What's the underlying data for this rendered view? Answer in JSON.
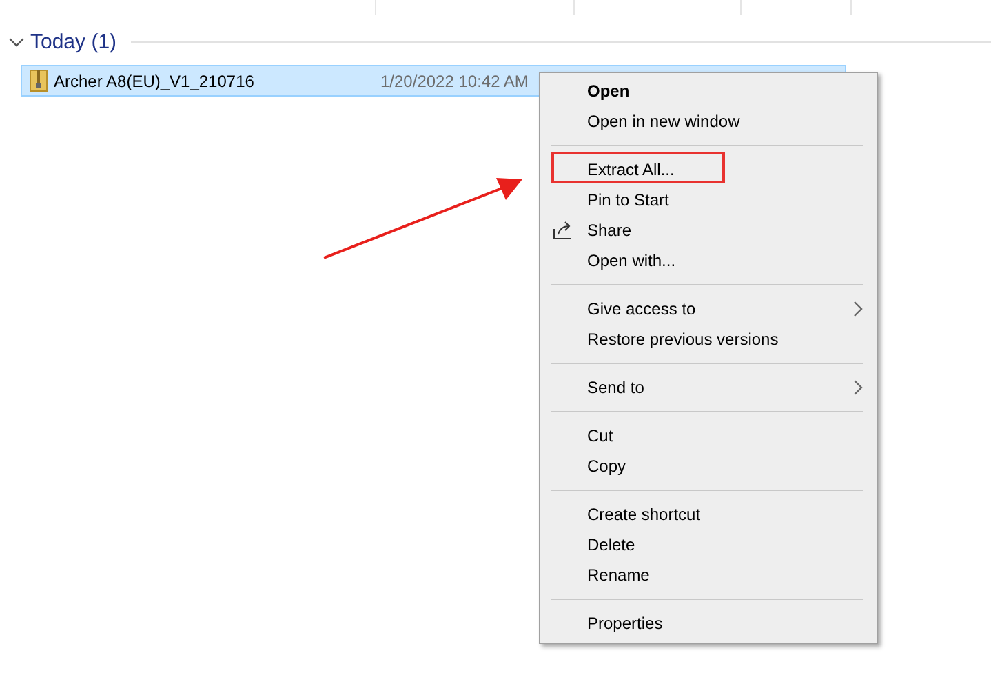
{
  "group": {
    "title": "Today (1)",
    "expanded": true
  },
  "files": [
    {
      "name": "Archer A8(EU)_V1_210716",
      "date_modified": "1/20/2022 10:42 AM",
      "selected": true
    }
  ],
  "context_menu": {
    "items": [
      {
        "kind": "item",
        "label": "Open",
        "default": true
      },
      {
        "kind": "item",
        "label": "Open in new window"
      },
      {
        "kind": "separator"
      },
      {
        "kind": "item",
        "label": "Extract All...",
        "annotated": true
      },
      {
        "kind": "item",
        "label": "Pin to Start"
      },
      {
        "kind": "icon_item",
        "label": "Share"
      },
      {
        "kind": "item",
        "label": "Open with..."
      },
      {
        "kind": "separator"
      },
      {
        "kind": "item",
        "label": "Give access to",
        "submenu": true
      },
      {
        "kind": "item",
        "label": "Restore previous versions"
      },
      {
        "kind": "separator"
      },
      {
        "kind": "item",
        "label": "Send to",
        "submenu": true
      },
      {
        "kind": "separator"
      },
      {
        "kind": "item",
        "label": "Cut"
      },
      {
        "kind": "item",
        "label": "Copy"
      },
      {
        "kind": "separator"
      },
      {
        "kind": "item",
        "label": "Create shortcut"
      },
      {
        "kind": "item",
        "label": "Delete"
      },
      {
        "kind": "item",
        "label": "Rename"
      },
      {
        "kind": "separator"
      },
      {
        "kind": "item",
        "label": "Properties"
      }
    ]
  },
  "annotation_arrow": true
}
